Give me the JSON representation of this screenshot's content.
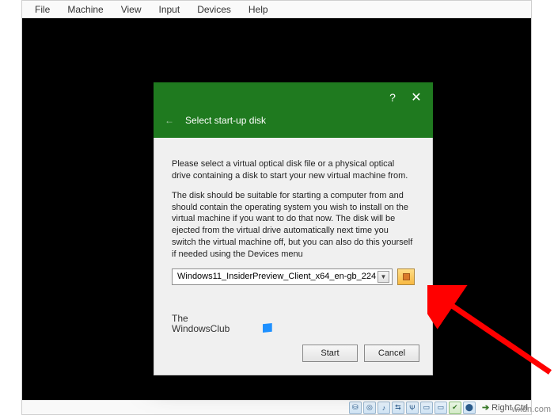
{
  "menubar": {
    "items": [
      "File",
      "Machine",
      "View",
      "Input",
      "Devices",
      "Help"
    ]
  },
  "dialog": {
    "title": "Select start-up disk",
    "para1": "Please select a virtual optical disk file or a physical optical drive containing a disk to start your new virtual machine from.",
    "para2": "The disk should be suitable for starting a computer from and should contain the operating system you wish to install on the virtual machine if you want to do that now. The disk will be ejected from the virtual drive automatically next time you switch the virtual machine off, but you can also do this yourself if needed using the Devices menu",
    "selected_disk": "Windows11_InsiderPreview_Client_x64_en-gb_224",
    "start_label": "Start",
    "cancel_label": "Cancel",
    "help_symbol": "?",
    "close_symbol": "✕",
    "back_symbol": "←"
  },
  "watermark": {
    "line1": "The",
    "line2": "WindowsClub"
  },
  "statusbar": {
    "icons": [
      "💾",
      "💿",
      "🖥",
      "🖧",
      "🖵",
      "🖵",
      "🖵",
      "✔",
      "⏺"
    ],
    "right_text": "Right Ctrl",
    "site": "wxdn.com"
  }
}
